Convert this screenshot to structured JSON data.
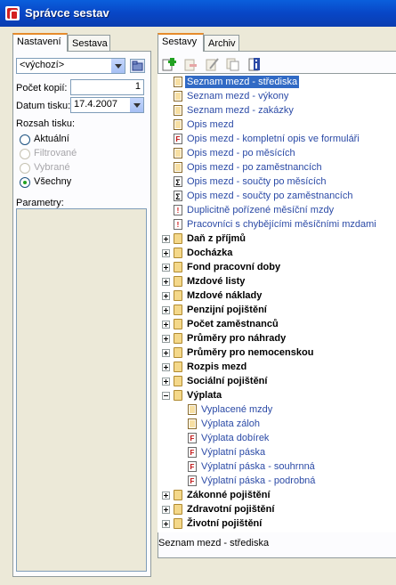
{
  "window": {
    "title": "Správce sestav"
  },
  "left_tabs": [
    "Nastavení",
    "Sestava"
  ],
  "right_tabs": [
    "Sestavy",
    "Archiv"
  ],
  "settings": {
    "template_value": "<výchozí>",
    "copies_label": "Počet kopií:",
    "copies_value": "1",
    "date_label": "Datum tisku:",
    "date_value": "17.4.2007",
    "range_label": "Rozsah tisku:",
    "range_options": [
      "Aktuální",
      "Filtrované",
      "Vybrané",
      "Všechny"
    ],
    "selected_range": "Všechny",
    "params_label": "Parametry:"
  },
  "toolbar_icons": [
    "add-report-icon",
    "delete-report-icon",
    "edit-report-icon",
    "copy-report-icon",
    "info-icon"
  ],
  "tree": [
    {
      "text": "Seznam mezd - střediska",
      "icon": "doc",
      "selected": true
    },
    {
      "text": "Seznam mezd - výkony",
      "icon": "doc"
    },
    {
      "text": "Seznam mezd - zakázky",
      "icon": "doc"
    },
    {
      "text": "Opis mezd",
      "icon": "doc"
    },
    {
      "text": "Opis mezd - kompletní opis ve formuláři",
      "icon": "F"
    },
    {
      "text": "Opis mezd - po měsících",
      "icon": "doc"
    },
    {
      "text": "Opis mezd - po zaměstnancích",
      "icon": "doc"
    },
    {
      "text": "Opis mezd - součty po měsících",
      "icon": "S"
    },
    {
      "text": "Opis mezd - součty po zaměstnancích",
      "icon": "S"
    },
    {
      "text": "Duplicitně pořízené měsíční mzdy",
      "icon": "X"
    },
    {
      "text": "Pracovníci s chybějícími měsíčními mzdami",
      "icon": "X"
    },
    {
      "text": "Daň z příjmů",
      "folder": true
    },
    {
      "text": "Docházka",
      "folder": true
    },
    {
      "text": "Fond pracovní doby",
      "folder": true
    },
    {
      "text": "Mzdové listy",
      "folder": true
    },
    {
      "text": "Mzdové náklady",
      "folder": true
    },
    {
      "text": "Penzijní pojištění",
      "folder": true
    },
    {
      "text": "Počet zaměstnanců",
      "folder": true
    },
    {
      "text": "Průměry pro náhrady",
      "folder": true
    },
    {
      "text": "Průměry pro nemocenskou",
      "folder": true
    },
    {
      "text": "Rozpis mezd",
      "folder": true
    },
    {
      "text": "Sociální pojištění",
      "folder": true
    },
    {
      "text": "Výplata",
      "folder": true,
      "expanded": true
    },
    {
      "text": "Vyplacené mzdy",
      "icon": "doc",
      "child": true
    },
    {
      "text": "Výplata záloh",
      "icon": "doc",
      "child": true
    },
    {
      "text": "Výplata dobírek",
      "icon": "F",
      "child": true
    },
    {
      "text": "Výplatní páska",
      "icon": "F",
      "child": true
    },
    {
      "text": "Výplatní páska - souhrnná",
      "icon": "F",
      "child": true
    },
    {
      "text": "Výplatní páska - podrobná",
      "icon": "F",
      "child": true
    },
    {
      "text": "Zákonné pojištění",
      "folder": true
    },
    {
      "text": "Zdravotní pojištění",
      "folder": true
    },
    {
      "text": "Životní pojištění",
      "folder": true
    }
  ],
  "status_text": "Seznam mezd - střediska"
}
